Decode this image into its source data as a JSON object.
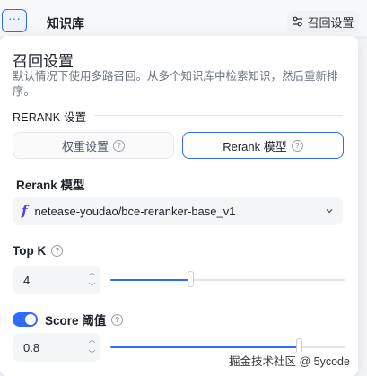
{
  "background": {
    "more_glyph": "···",
    "kb_title": "知识库",
    "recall_button_label": "召回设置"
  },
  "panel": {
    "title": "召回设置",
    "description": "默认情况下使用多路召回。从多个知识库中检索知识，然后重新排序。",
    "section_title": "RERANK 设置",
    "tabs": [
      {
        "label": "权重设置",
        "selected": false
      },
      {
        "label": "Rerank 模型",
        "selected": true
      }
    ],
    "rerank_model": {
      "label": "Rerank 模型",
      "logo_glyph": "f",
      "value": "netease-youdao/bce-reranker-base_v1"
    },
    "top_k": {
      "label": "Top K",
      "value": "4",
      "slider_fraction": 0.34
    },
    "score_threshold": {
      "label": "Score 阈值",
      "enabled": true,
      "value": "0.8",
      "slider_fraction": 0.8
    },
    "help_glyph": "?"
  },
  "watermark": "掘金技术社区 @ 5ycode",
  "colors": {
    "accent": "#2f6bff",
    "logo": "#5b3fd6"
  },
  "icons": [
    "more-icon",
    "recall-settings-icon",
    "help-icon",
    "model-logo-icon",
    "chevron-down-icon",
    "stepper-up-icon",
    "stepper-down-icon",
    "toggle-icon"
  ]
}
